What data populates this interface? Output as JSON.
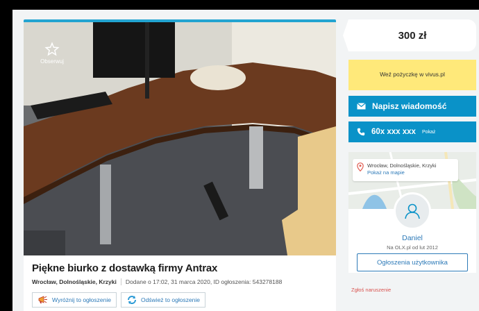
{
  "listing": {
    "observe_label": "Obserwuj",
    "title": "Piękne biurko z dostawką firmy Antrax",
    "location": "Wrocław, Dolnośląskie, Krzyki",
    "added": "Dodane o 17:02, 31 marca 2020, ID ogłoszenia: 543278188",
    "promote_label": "Wyróżnij to ogłoszenie",
    "refresh_label": "Odśwież to ogłoszenie"
  },
  "sidebar": {
    "price": "300 zł",
    "loan_label": "Weź pożyczkę w vivus.pl",
    "message_label": "Napisz wiadomość",
    "phone_number": "60x xxx xxx",
    "phone_show": "Pokaż",
    "map_location": "Wrocław, Dolnośląskie, Krzyki",
    "map_link": "Pokaż na mapie",
    "user_name": "Daniel",
    "user_since": "Na OLX.pl od lut 2012",
    "user_ads_label": "Ogłoszenia użytkownika",
    "report_label": "Zgłoś naruszenie"
  },
  "colors": {
    "accent": "#0a92c8",
    "loan_bg": "#ffe97a",
    "link": "#2d7ab8",
    "report": "#d9534f"
  },
  "icons": [
    "star-icon",
    "megaphone-icon",
    "refresh-icon",
    "envelope-icon",
    "phone-icon",
    "map-pin-icon",
    "user-icon"
  ]
}
